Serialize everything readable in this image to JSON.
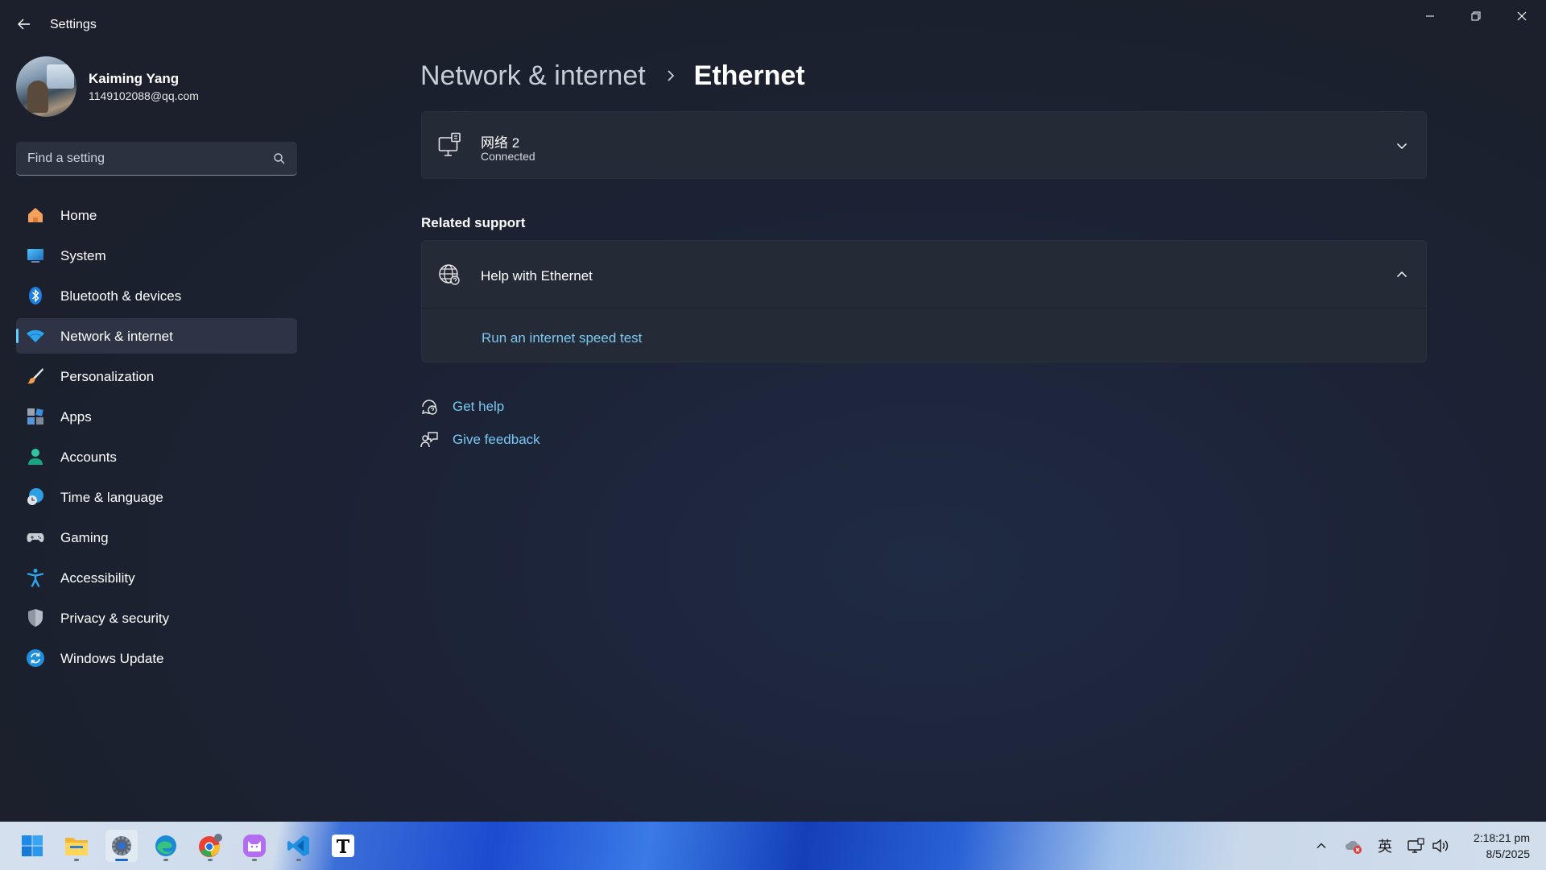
{
  "app": {
    "title": "Settings"
  },
  "profile": {
    "name": "Kaiming Yang",
    "email": "1149102088@qq.com"
  },
  "search": {
    "placeholder": "Find a setting"
  },
  "nav": {
    "items": [
      {
        "label": "Home",
        "icon": "home-icon"
      },
      {
        "label": "System",
        "icon": "system-icon"
      },
      {
        "label": "Bluetooth & devices",
        "icon": "bluetooth-icon"
      },
      {
        "label": "Network & internet",
        "icon": "wifi-icon",
        "active": true
      },
      {
        "label": "Personalization",
        "icon": "brush-icon"
      },
      {
        "label": "Apps",
        "icon": "apps-icon"
      },
      {
        "label": "Accounts",
        "icon": "accounts-icon"
      },
      {
        "label": "Time & language",
        "icon": "time-language-icon"
      },
      {
        "label": "Gaming",
        "icon": "gamepad-icon"
      },
      {
        "label": "Accessibility",
        "icon": "accessibility-icon"
      },
      {
        "label": "Privacy & security",
        "icon": "shield-icon"
      },
      {
        "label": "Windows Update",
        "icon": "update-icon"
      }
    ]
  },
  "breadcrumb": {
    "parent": "Network & internet",
    "current": "Ethernet"
  },
  "network": {
    "name": "网络 2",
    "status": "Connected"
  },
  "related_support": {
    "title": "Related support",
    "help_label": "Help with Ethernet",
    "link": "Run an internet speed test"
  },
  "links": {
    "get_help": "Get help",
    "give_feedback": "Give feedback"
  },
  "taskbar": {
    "apps": [
      "start-icon",
      "file-explorer-icon",
      "settings-icon",
      "edge-icon",
      "chrome-icon",
      "cat-app-icon",
      "vscode-icon",
      "typora-icon"
    ],
    "ime": "英",
    "time": "2:18:21 pm",
    "date": "8/5/2025"
  },
  "colors": {
    "accent": "#60cdff",
    "link": "#7cc8f2"
  }
}
